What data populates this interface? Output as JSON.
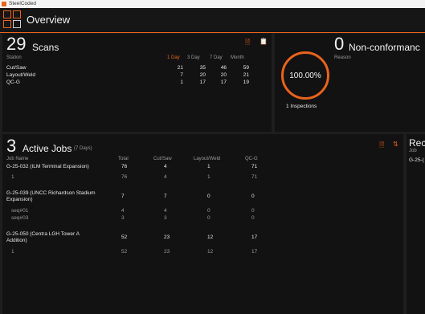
{
  "titlebar": {
    "app_title": "SteelCoded"
  },
  "header": {
    "page_title": "Overview"
  },
  "scans": {
    "count": "29",
    "title": "Scans",
    "station_header": "Station",
    "period_headers": [
      "1 Day",
      "3 Day",
      "7 Day",
      "Month"
    ],
    "rows": [
      {
        "station": "Cut/Saw",
        "values": [
          "21",
          "35",
          "46",
          "59"
        ]
      },
      {
        "station": "Layout/Weld",
        "values": [
          "7",
          "20",
          "20",
          "21"
        ]
      },
      {
        "station": "QC-G",
        "values": [
          "1",
          "17",
          "17",
          "19"
        ]
      }
    ],
    "icons": [
      "document-icon",
      "clipboard-icon"
    ]
  },
  "nonconformance": {
    "count": "0",
    "title": "Non-conformanc",
    "reason_header": "Reason",
    "percent": "100.00%",
    "inspections": "1 Inspections"
  },
  "active_jobs": {
    "count": "3",
    "title": "Active Jobs",
    "subtitle": "(7 Days)",
    "headers": [
      "Job Name",
      "Total",
      "Cut/Saw",
      "Layout/Weld",
      "QC-G"
    ],
    "jobs": [
      {
        "name": "G-25-032 (ILM Terminal Expansion)",
        "values": [
          "76",
          "4",
          "1",
          "71"
        ],
        "seqs": [
          {
            "name": "1",
            "values": [
              "76",
              "4",
              "1",
              "71"
            ]
          }
        ]
      },
      {
        "name": "G-25-039 (UNCC Richardson Stadium Expansion)",
        "values": [
          "7",
          "7",
          "0",
          "0"
        ],
        "seqs": [
          {
            "name": "seq#01",
            "values": [
              "4",
              "4",
              "0",
              "0"
            ]
          },
          {
            "name": "seq#03",
            "values": [
              "3",
              "3",
              "0",
              "0"
            ]
          }
        ]
      },
      {
        "name": "G-25-050 (Centra LGH Tower A Addition)",
        "values": [
          "52",
          "23",
          "12",
          "17"
        ],
        "seqs": [
          {
            "name": "1",
            "values": [
              "52",
              "23",
              "12",
              "17"
            ]
          }
        ]
      }
    ],
    "icons": [
      "document-icon",
      "sort-icon"
    ]
  },
  "recent": {
    "title": "Rec",
    "header": "Job",
    "first": "G-25-("
  },
  "colors": {
    "accent": "#e8631c",
    "panel": "#121212",
    "background": "#1e1e1e"
  }
}
